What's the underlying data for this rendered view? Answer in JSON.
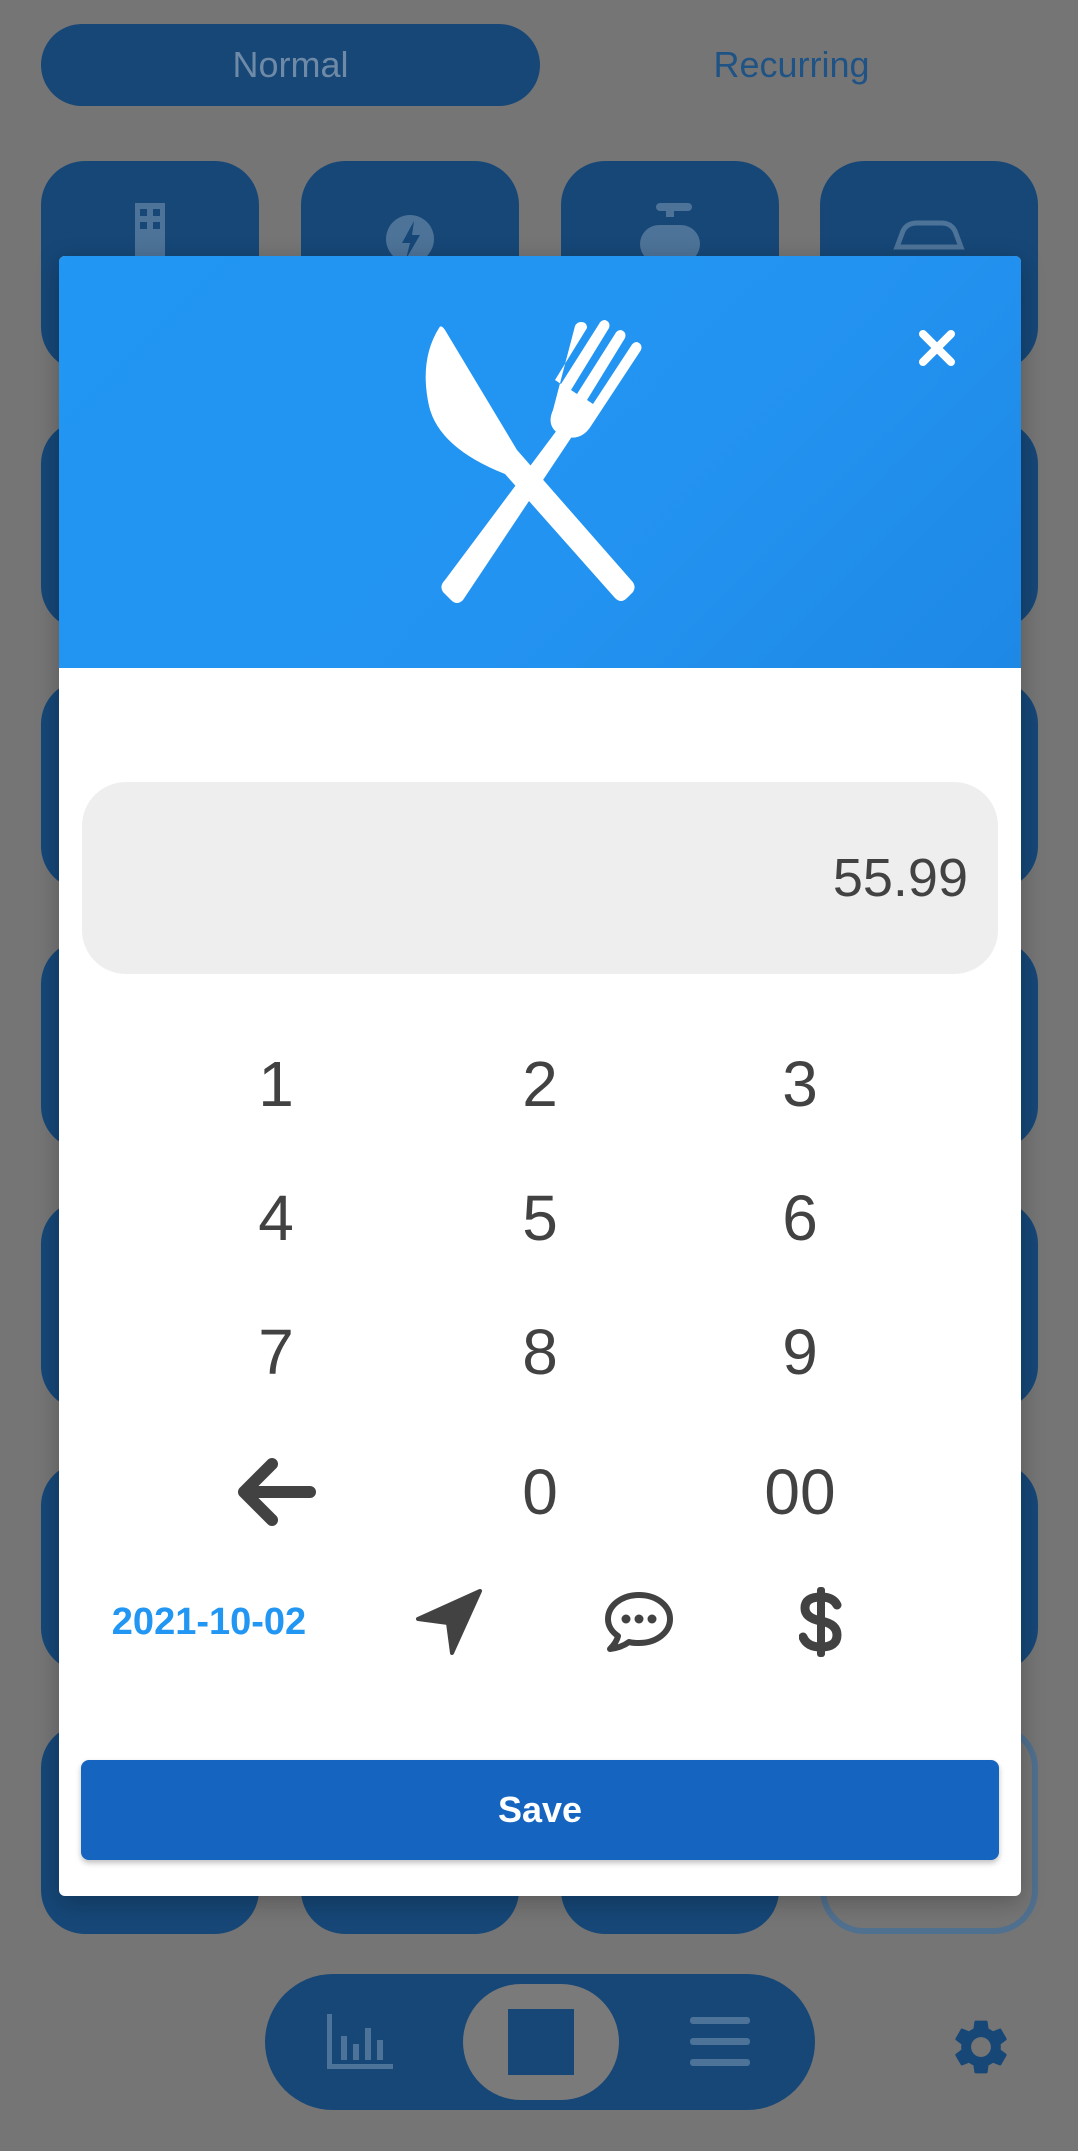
{
  "tabs": {
    "normal": "Normal",
    "recurring": "Recurring"
  },
  "category_icons": [
    "building-icon",
    "lightning-icon",
    "watering-can-icon",
    "car-icon"
  ],
  "dialog": {
    "header_icon": "fork-knife-icon",
    "close_icon": "close-icon",
    "amount": "55.99",
    "keys": [
      "1",
      "2",
      "3",
      "4",
      "5",
      "6",
      "7",
      "8",
      "9",
      "",
      "0",
      "00"
    ],
    "backspace_icon": "arrow-left-icon",
    "date": "2021-10-02",
    "location_icon": "location-arrow-icon",
    "comment_icon": "comment-icon",
    "currency_icon": "dollar-icon",
    "save_label": "Save"
  },
  "bottom_nav": {
    "stats_icon": "bar-chart-icon",
    "home_icon": "square-icon",
    "menu_icon": "menu-icon"
  },
  "colors": {
    "primary": "#2196f3",
    "primary_dark": "#1565c0",
    "overlay": "#757575",
    "text": "#424242"
  }
}
